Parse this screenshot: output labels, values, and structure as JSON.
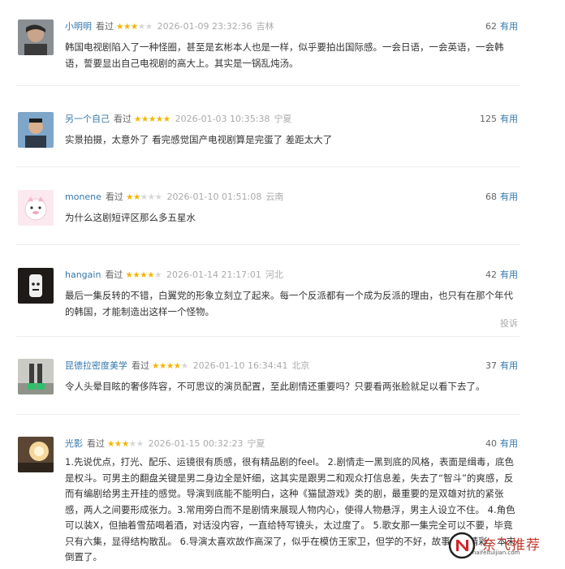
{
  "reviews": [
    {
      "username": "小明明",
      "watched": "看过",
      "rating": 3,
      "date": "2026-01-09 23:32:36",
      "location": "吉林",
      "votes": "62",
      "vote_label": "有用",
      "content": "韩国电视剧陷入了一种怪圈，甚至是玄彬本人也是一样，似乎要拍出国际感。一会日语，一会英语，一会韩语，誓要显出自己电视剧的高大上。其实是一锅乱炖汤。"
    },
    {
      "username": "另一个自己",
      "watched": "看过",
      "rating": 5,
      "date": "2026-01-03 10:35:38",
      "location": "宁夏",
      "votes": "125",
      "vote_label": "有用",
      "content": "实景拍摄，太意外了 看完感觉国产电视剧算是完蛋了 差距太大了"
    },
    {
      "username": "monene",
      "watched": "看过",
      "rating": 2,
      "date": "2026-01-10 01:51:08",
      "location": "云南",
      "votes": "68",
      "vote_label": "有用",
      "content": "为什么这剧短评区那么多五星水"
    },
    {
      "username": "hangain",
      "watched": "看过",
      "rating": 4,
      "date": "2026-01-14 21:17:01",
      "location": "河北",
      "votes": "42",
      "vote_label": "有用",
      "content": "最后一集反转的不错，白翼党的形象立刻立了起来。每一个反派都有一个成为反派的理由，也只有在那个年代的韩国，才能制造出这样一个怪物。",
      "report": "投诉"
    },
    {
      "username": "昆德拉密度美学",
      "watched": "看过",
      "rating": 4,
      "date": "2026-01-10 16:34:41",
      "location": "北京",
      "votes": "37",
      "vote_label": "有用",
      "content": "令人头晕目眩的奢侈阵容，不可思议的演员配置，至此剧情还重要吗？只要看两张脸就足以看下去了。"
    },
    {
      "username": "光影",
      "watched": "看过",
      "rating": 3,
      "date": "2026-01-15 00:32:23",
      "location": "宁夏",
      "votes": "40",
      "vote_label": "有用",
      "content": "1.先说优点，打光、配乐、运镜很有质感，很有精品剧的feel。 2.剧情走一黑到底的风格，表面是缉毒，底色是权斗。可男主的翻盘关键是男二身边全是奸细，这其实是跟男二和观众打信息差，失去了“智斗”的爽感，反而有编剧给男主开挂的感觉。导演到底能不能明白，这种《猫鼠游戏》类的剧，最重要的是双雄对抗的紧张感，两人之间要形成张力。3.常用旁白而不是剧情来展现人物内心，使得人物悬浮，男主人设立不住。 4.角色可以装X，但抽着雪茄喝着酒，对话没内容，一直给特写镜头，太过度了。 5.歌女那一集完全可以不要，毕竟只有六集，显得结构散乱。 6.导演太喜欢故作高深了，似乎在模仿王家卫，但学的不好，故事讲不精彩，本末倒置了。"
    }
  ],
  "watermark": {
    "brand": "奈飞推荐",
    "url": "naifeituijian.com"
  },
  "colors": {
    "link": "#3377aa",
    "star_on": "#f4b400",
    "star_off": "#d6d6d6",
    "meta": "#aaaaaa"
  }
}
